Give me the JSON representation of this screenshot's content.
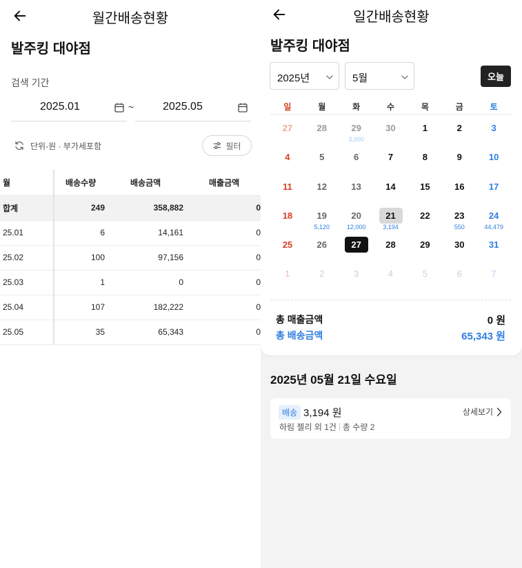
{
  "left": {
    "title": "월간배송현황",
    "store": "발주킹 대야점",
    "period_label": "검색 기간",
    "date_from": "2025.01",
    "date_sep": "~",
    "date_to": "2025.05",
    "unit_note": "단위-원 · 부가세포함",
    "filter_label": "필터",
    "table": {
      "headers": [
        "월",
        "배송수량",
        "배송금액",
        "매출금액"
      ],
      "total": [
        "합계",
        "249",
        "358,882",
        "0"
      ],
      "rows": [
        [
          "25.01",
          "6",
          "14,161",
          "0"
        ],
        [
          "25.02",
          "100",
          "97,156",
          "0"
        ],
        [
          "25.03",
          "1",
          "0",
          "0"
        ],
        [
          "25.04",
          "107",
          "182,222",
          "0"
        ],
        [
          "25.05",
          "35",
          "65,343",
          "0"
        ]
      ]
    }
  },
  "right": {
    "title": "일간배송현황",
    "store": "발주킹 대야점",
    "year_select": "2025년",
    "month_select": "5월",
    "today_label": "오늘",
    "weekdays": [
      "일",
      "월",
      "화",
      "수",
      "목",
      "금",
      "토"
    ],
    "weeks": [
      [
        {
          "d": "27",
          "t": "mute"
        },
        {
          "d": "28",
          "t": "mute"
        },
        {
          "d": "29",
          "t": "mute",
          "a": "3,000"
        },
        {
          "d": "30",
          "t": "mute"
        },
        {
          "d": "1"
        },
        {
          "d": "2"
        },
        {
          "d": "3"
        }
      ],
      [
        {
          "d": "4"
        },
        {
          "d": "5",
          "t": "mid"
        },
        {
          "d": "6",
          "t": "mid"
        },
        {
          "d": "7"
        },
        {
          "d": "8"
        },
        {
          "d": "9"
        },
        {
          "d": "10"
        }
      ],
      [
        {
          "d": "11"
        },
        {
          "d": "12",
          "t": "mid"
        },
        {
          "d": "13",
          "t": "mid"
        },
        {
          "d": "14"
        },
        {
          "d": "15"
        },
        {
          "d": "16"
        },
        {
          "d": "17"
        }
      ],
      [
        {
          "d": "18"
        },
        {
          "d": "19",
          "t": "mid",
          "a": "5,120"
        },
        {
          "d": "20",
          "t": "mid",
          "a": "12,000"
        },
        {
          "d": "21",
          "t": "sel-grey",
          "a": "3,194"
        },
        {
          "d": "22"
        },
        {
          "d": "23",
          "a": "550"
        },
        {
          "d": "24",
          "a": "44,479"
        }
      ],
      [
        {
          "d": "25"
        },
        {
          "d": "26",
          "t": "mid"
        },
        {
          "d": "27",
          "t": "sel-black"
        },
        {
          "d": "28"
        },
        {
          "d": "29"
        },
        {
          "d": "30"
        },
        {
          "d": "31"
        }
      ],
      [
        {
          "d": "1",
          "t": "far"
        },
        {
          "d": "2",
          "t": "far"
        },
        {
          "d": "3",
          "t": "far"
        },
        {
          "d": "4",
          "t": "far"
        },
        {
          "d": "5",
          "t": "far"
        },
        {
          "d": "6",
          "t": "far"
        },
        {
          "d": "7",
          "t": "far"
        }
      ]
    ],
    "sales_label": "총 매출금액",
    "sales_value": "0 원",
    "ship_label": "총 배송금액",
    "ship_value": "65,343 원",
    "selected_date_title": "2025년 05월 21일 수요일",
    "detail": {
      "badge": "배송",
      "amount": "3,194 원",
      "more_label": "상세보기",
      "items": "하림 젤리 외 1건",
      "qty": "총 수량 2"
    }
  },
  "colors": {
    "sunday": "#d93e22",
    "saturday": "#2f7de1",
    "accent_blue": "#2f7de1",
    "dark_button": "#222222",
    "panel_bg": "#f3f3f3"
  },
  "icons": [
    "back-arrow-icon",
    "calendar-icon",
    "refresh-icon",
    "filter-sliders-icon",
    "chevron-down-icon",
    "chevron-right-icon"
  ]
}
